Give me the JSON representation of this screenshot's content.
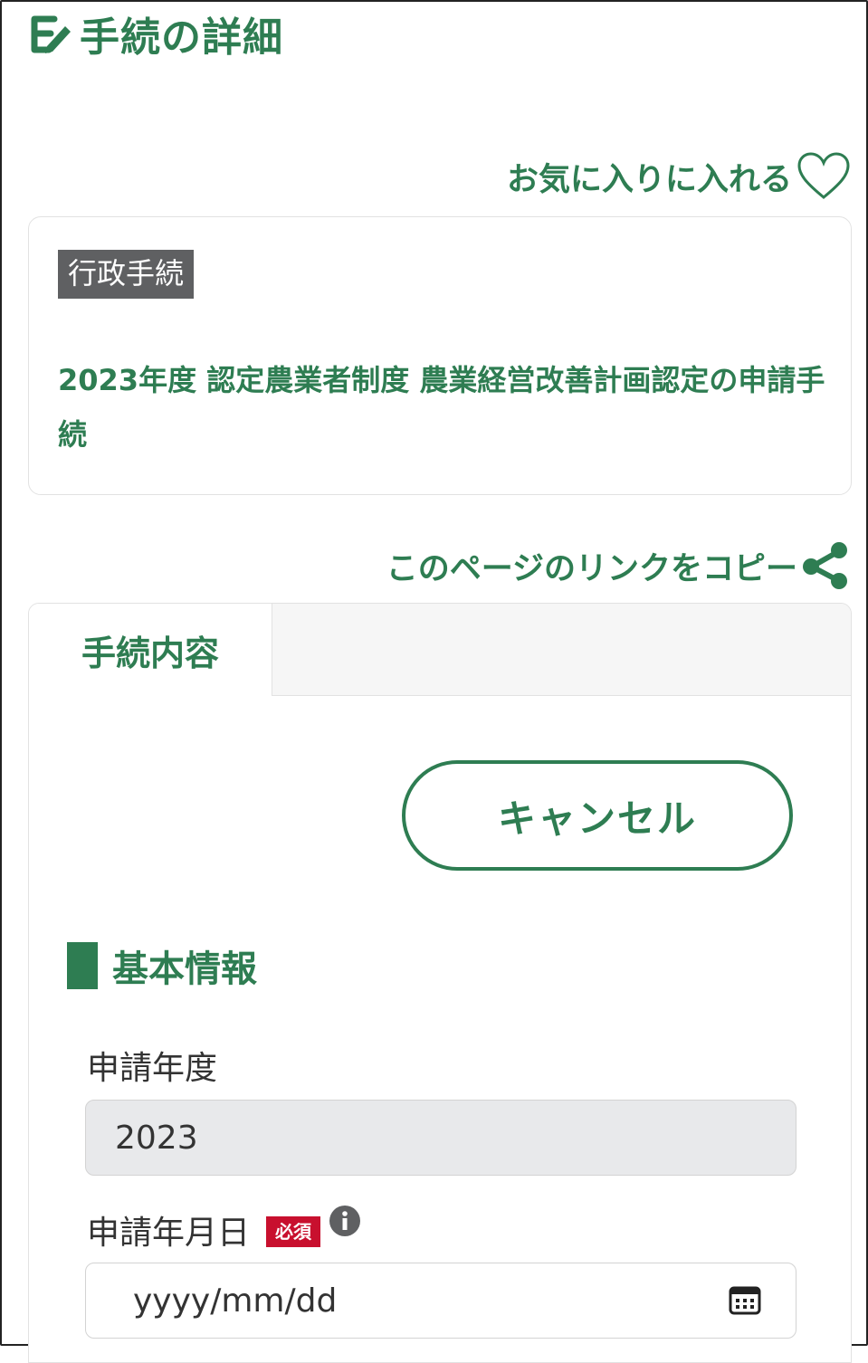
{
  "header": {
    "title": "手続の詳細",
    "icon": "procedure-icon"
  },
  "favorite": {
    "label": "お気に入りに入れる",
    "icon": "heart-icon"
  },
  "procedure_card": {
    "category_badge": "行政手続",
    "title": "2023年度 認定農業者制度 農業経営改善計画認定の申請手続"
  },
  "copy_link": {
    "label": "このページのリンクをコピー",
    "icon": "share-icon"
  },
  "tabs": [
    {
      "label": "手続内容",
      "active": true
    }
  ],
  "cancel_button": {
    "label": "キャンセル"
  },
  "basic_info": {
    "heading": "基本情報",
    "application_year": {
      "label": "申請年度",
      "value": "2023"
    },
    "application_date": {
      "label": "申請年月日",
      "required_badge": "必須",
      "placeholder": "yyyy/mm/dd"
    }
  },
  "colors": {
    "accent": "#2e7d52",
    "badge_bg": "#5f6062",
    "required": "#c8102e",
    "readonly_bg": "#e8e9eb"
  }
}
